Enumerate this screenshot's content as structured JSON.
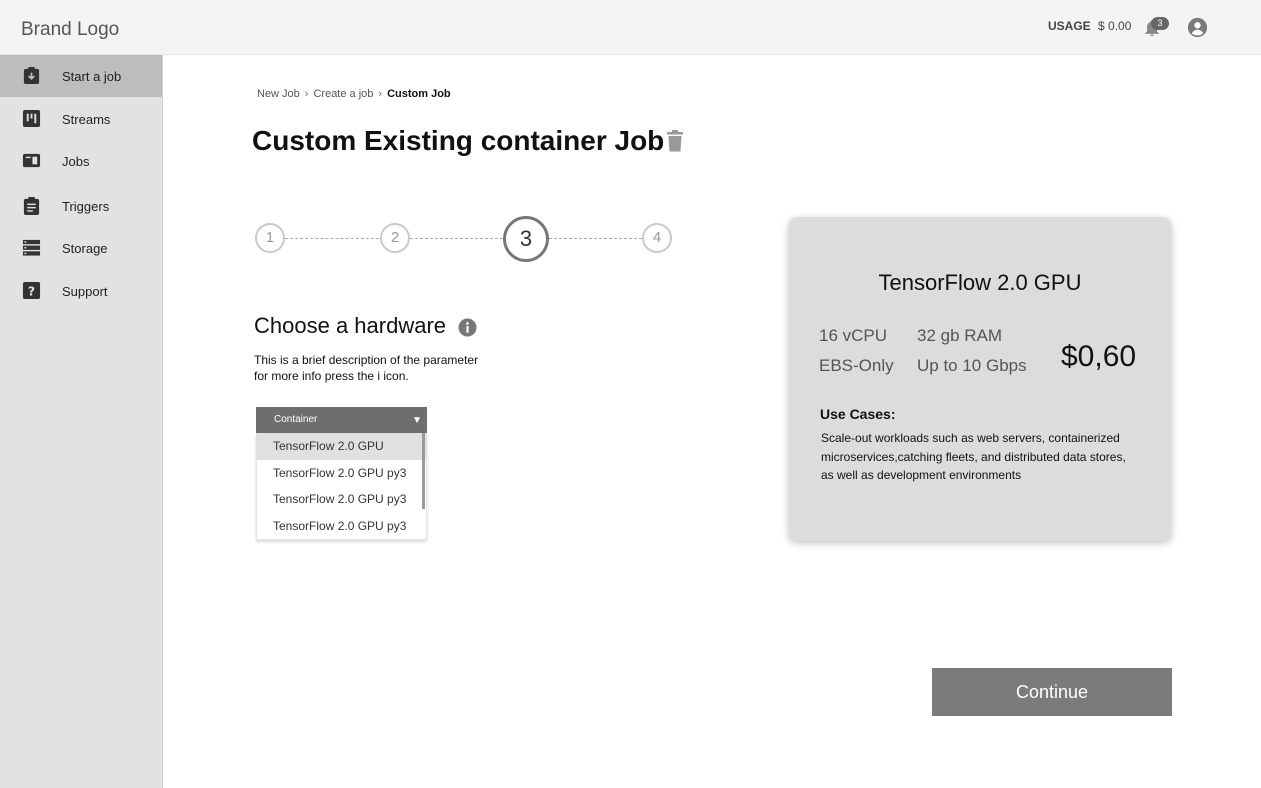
{
  "header": {
    "brand": "Brand Logo",
    "usage_label": "USAGE",
    "usage_value": "$ 0.00",
    "notification_count": "3"
  },
  "sidebar": {
    "items": [
      {
        "label": "Start a job",
        "icon": "clipboard-download-icon",
        "active": true
      },
      {
        "label": "Streams",
        "icon": "streams-icon"
      },
      {
        "label": "Jobs",
        "icon": "jobs-icon"
      },
      {
        "label": "Triggers",
        "icon": "clipboard-list-icon"
      },
      {
        "label": "Storage",
        "icon": "storage-icon"
      },
      {
        "label": "Support",
        "icon": "help-icon"
      }
    ]
  },
  "breadcrumb": [
    "New Job",
    "Create a job",
    "Custom Job"
  ],
  "page": {
    "title": "Custom Existing container Job"
  },
  "stepper": {
    "steps": [
      "1",
      "2",
      "3",
      "4"
    ],
    "current": 3
  },
  "hardware": {
    "title": "Choose a hardware",
    "description": "This is a brief description of the parameter for more info press the i icon.",
    "dropdown_label": "Container",
    "options": [
      "TensorFlow 2.0 GPU",
      "TensorFlow 2.0 GPU py3",
      "TensorFlow 2.0 GPU py3",
      "TensorFlow 2.0 GPU py3"
    ],
    "selected_index": 0
  },
  "card": {
    "title": "TensorFlow 2.0 GPU",
    "cpu": "16 vCPU",
    "ram": "32 gb RAM",
    "storage": "EBS-Only",
    "network": "Up to 10 Gbps",
    "price": "$0,60",
    "use_cases_title": "Use Cases:",
    "use_cases_text": "Scale-out workloads such as web servers, containerized microservices,catching fleets, and distributed data stores, as well as development environments"
  },
  "actions": {
    "continue_label": "Continue"
  },
  "colors": {
    "sidebar_bg": "#e2e2e2",
    "sidebar_active": "#bdbdbd",
    "button_bg": "#7b7b7b",
    "card_bg": "#dcdcdc"
  }
}
